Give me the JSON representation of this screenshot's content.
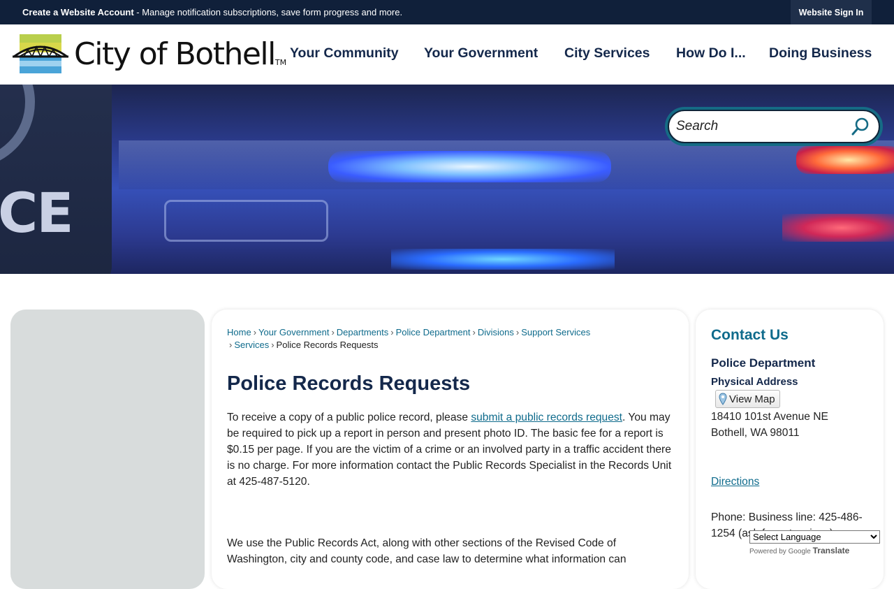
{
  "topbar": {
    "create_account": "Create a Website Account",
    "create_account_desc": " - Manage notification subscriptions, save form progress and more.",
    "sign_in": "Website Sign In"
  },
  "header": {
    "logo_text": "City of Bothell",
    "logo_tm": "TM",
    "nav": [
      "Your Community",
      "Your Government",
      "City Services",
      "How Do I...",
      "Doing Business"
    ]
  },
  "hero": {
    "patch_text": "ICE",
    "search_placeholder": "Search",
    "search_icon": "search-icon"
  },
  "breadcrumb": {
    "items": [
      "Home",
      "Your Government",
      "Departments",
      "Police Department",
      "Divisions",
      "Support Services",
      "Services"
    ],
    "current": "Police Records Requests",
    "separator": "›"
  },
  "main": {
    "title": "Police Records Requests",
    "para1_pre": "To receive a copy of a public police record, please ",
    "para1_link": "submit a public records request",
    "para1_post": ". You may be required to pick up a report in person and present photo ID. The basic fee for a report is $0.15 per page. If you are the victim of a crime or an involved party in a traffic accident there is no charge. For more information contact the Public Records Specialist in the Records Unit at 425-487-5120.",
    "para2": "We use the Public Records Act, along with other sections of the Revised Code of Washington, city and county code, and case law to determine what information can"
  },
  "contact": {
    "heading": "Contact Us",
    "dept": "Police Department",
    "address_label": "Physical Address",
    "view_map": "View Map",
    "address_line1": "18410 101st Avenue NE",
    "address_line2": "Bothell, WA 98011",
    "directions": "Directions",
    "phone": "Phone: Business line: 425-486-1254 (ask for extensions)"
  },
  "translate": {
    "select_label": "Select Language",
    "powered_by": "Powered by",
    "google": "Google",
    "translate": "Translate"
  },
  "colors": {
    "navy": "#14284b",
    "topbar": "#10203a",
    "link": "#0f6b8c",
    "search_ring": "#156b85",
    "sidebar_gray": "#d8dcdc"
  }
}
